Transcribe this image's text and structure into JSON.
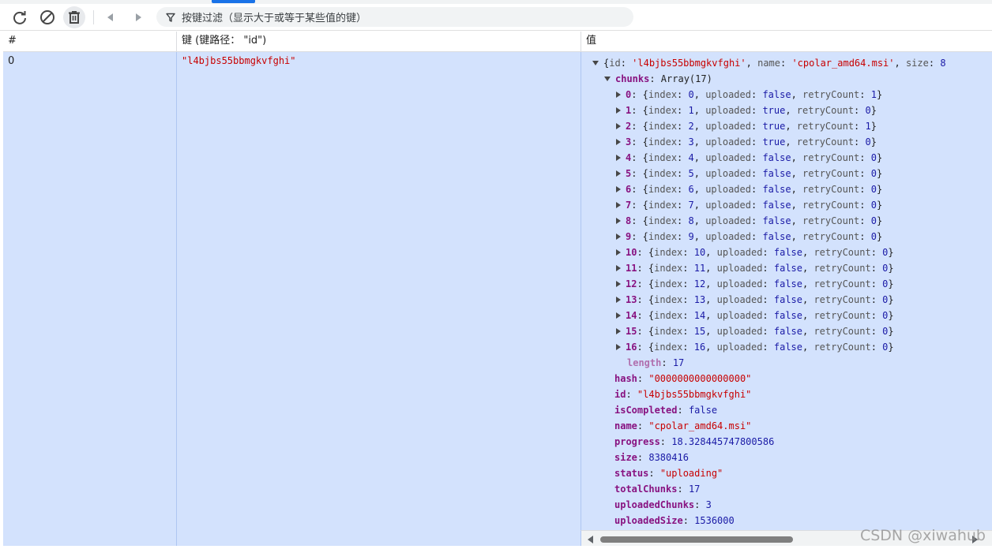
{
  "toolbar": {
    "refresh_icon": "refresh-icon",
    "clear_icon": "block-icon",
    "delete_icon": "trash-icon",
    "prev_icon": "triangle-left-icon",
    "next_icon": "triangle-right-icon",
    "filter_icon": "funnel-icon",
    "filter_placeholder": "按键过滤（显示大于或等于某些值的键）"
  },
  "columns": {
    "num": "#",
    "key": "键 (键路径： \"id\")",
    "value": "值"
  },
  "row": {
    "num": "0",
    "key": "\"l4bjbs55bbmgkvfghi\""
  },
  "record": {
    "summary": {
      "id": "'l4bjbs55bbmgkvfghi'",
      "name": "'cpolar_amd64.msi'",
      "size_partial": "8"
    },
    "chunks_label": "chunks",
    "chunks_type": "Array(17)",
    "chunks": [
      {
        "i": "0",
        "index": "0",
        "uploaded": "false",
        "retry": "1"
      },
      {
        "i": "1",
        "index": "1",
        "uploaded": "true",
        "retry": "0"
      },
      {
        "i": "2",
        "index": "2",
        "uploaded": "true",
        "retry": "1"
      },
      {
        "i": "3",
        "index": "3",
        "uploaded": "true",
        "retry": "0"
      },
      {
        "i": "4",
        "index": "4",
        "uploaded": "false",
        "retry": "0"
      },
      {
        "i": "5",
        "index": "5",
        "uploaded": "false",
        "retry": "0"
      },
      {
        "i": "6",
        "index": "6",
        "uploaded": "false",
        "retry": "0"
      },
      {
        "i": "7",
        "index": "7",
        "uploaded": "false",
        "retry": "0"
      },
      {
        "i": "8",
        "index": "8",
        "uploaded": "false",
        "retry": "0"
      },
      {
        "i": "9",
        "index": "9",
        "uploaded": "false",
        "retry": "0"
      },
      {
        "i": "10",
        "index": "10",
        "uploaded": "false",
        "retry": "0"
      },
      {
        "i": "11",
        "index": "11",
        "uploaded": "false",
        "retry": "0"
      },
      {
        "i": "12",
        "index": "12",
        "uploaded": "false",
        "retry": "0"
      },
      {
        "i": "13",
        "index": "13",
        "uploaded": "false",
        "retry": "0"
      },
      {
        "i": "14",
        "index": "14",
        "uploaded": "false",
        "retry": "0"
      },
      {
        "i": "15",
        "index": "15",
        "uploaded": "false",
        "retry": "0"
      },
      {
        "i": "16",
        "index": "16",
        "uploaded": "false",
        "retry": "0"
      }
    ],
    "length": "17",
    "fields": [
      {
        "key": "hash",
        "value": "\"0000000000000000\"",
        "kind": "str"
      },
      {
        "key": "id",
        "value": "\"l4bjbs55bbmgkvfghi\"",
        "kind": "str"
      },
      {
        "key": "isCompleted",
        "value": "false",
        "kind": "kw"
      },
      {
        "key": "name",
        "value": "\"cpolar_amd64.msi\"",
        "kind": "str"
      },
      {
        "key": "progress",
        "value": "18.328445747800586",
        "kind": "num"
      },
      {
        "key": "size",
        "value": "8380416",
        "kind": "num"
      },
      {
        "key": "status",
        "value": "\"uploading\"",
        "kind": "str"
      },
      {
        "key": "totalChunks",
        "value": "17",
        "kind": "num"
      },
      {
        "key": "uploadedChunks",
        "value": "3",
        "kind": "num"
      },
      {
        "key": "uploadedSize",
        "value": "1536000",
        "kind": "num"
      }
    ]
  },
  "watermark": "CSDN @xiwahub",
  "colors": {
    "row_selected": "#d3e2fd",
    "string": "#c80000",
    "keyword": "#1a1aa6",
    "property": "#881280"
  }
}
